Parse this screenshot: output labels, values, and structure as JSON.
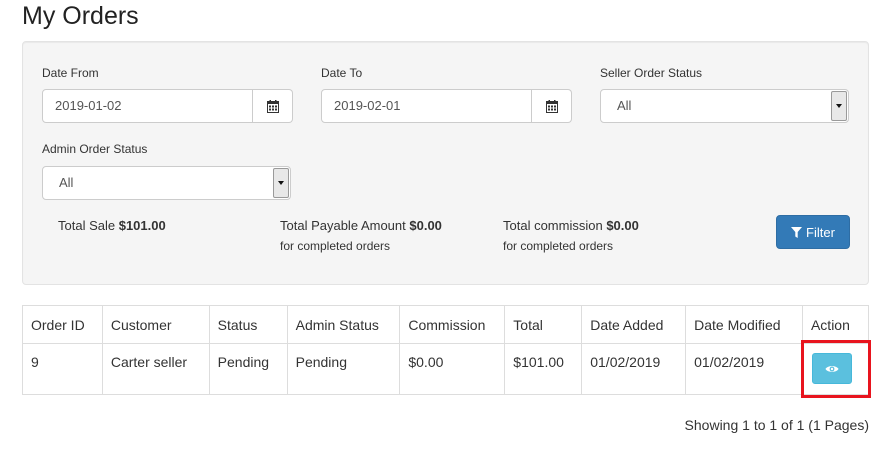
{
  "page": {
    "title": "My Orders"
  },
  "filters": {
    "date_from": {
      "label": "Date From",
      "value": "2019-01-02"
    },
    "date_to": {
      "label": "Date To",
      "value": "2019-02-01"
    },
    "seller_order_status": {
      "label": "Seller Order Status",
      "value": "All"
    },
    "admin_order_status": {
      "label": "Admin Order Status",
      "value": "All"
    },
    "filter_button": "Filter"
  },
  "summary": {
    "total_sale_label": "Total Sale",
    "total_sale_value": "$101.00",
    "total_payable_label": "Total Payable Amount",
    "total_payable_value": "$0.00",
    "total_payable_note": "for completed orders",
    "total_commission_label": "Total commission",
    "total_commission_value": "$0.00",
    "total_commission_note": "for completed orders"
  },
  "table": {
    "headers": [
      "Order ID",
      "Customer",
      "Status",
      "Admin Status",
      "Commission",
      "Total",
      "Date Added",
      "Date Modified",
      "Action"
    ],
    "rows": [
      {
        "order_id": "9",
        "customer": "Carter seller",
        "status": "Pending",
        "admin_status": "Pending",
        "commission": "$0.00",
        "total": "$101.00",
        "date_added": "01/02/2019",
        "date_modified": "01/02/2019"
      }
    ]
  },
  "pagination": {
    "info": "Showing 1 to 1 of 1 (1 Pages)"
  },
  "colors": {
    "primary": "#337ab7",
    "info": "#5bc0de",
    "highlight": "#e8141e"
  }
}
